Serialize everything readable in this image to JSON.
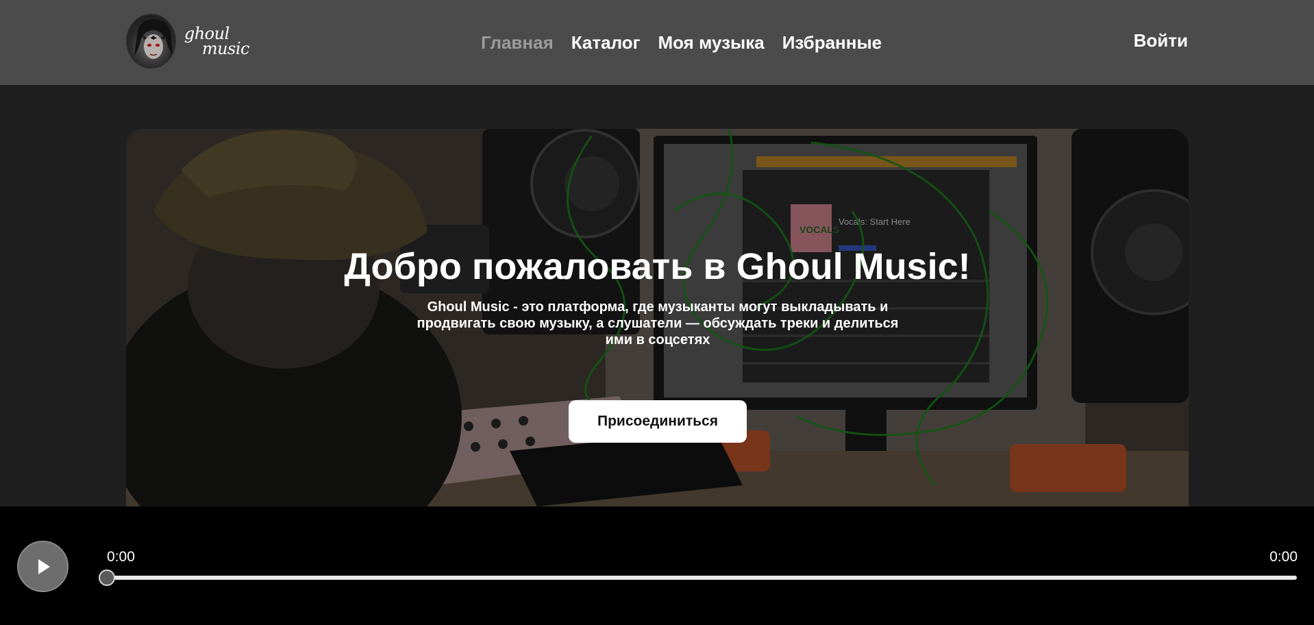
{
  "header": {
    "logo": {
      "line1": "ghoul",
      "line2": "music"
    },
    "nav": [
      {
        "label": "Главная",
        "active": true
      },
      {
        "label": "Каталог",
        "active": false
      },
      {
        "label": "Моя музыка",
        "active": false
      },
      {
        "label": "Избранные",
        "active": false
      }
    ],
    "login_label": "Войти"
  },
  "hero": {
    "title": "Добро пожаловать в Ghoul Music!",
    "description": "Ghoul Music - это платформа, где музыканты могут выкладывать и продвигать свою музыку, а слушатели — обсуждать треки и делиться ими в соцсетях",
    "join_label": "Присоединиться",
    "screen_text": {
      "heading": "Vocals: Start Here",
      "cover": "VOCALS"
    }
  },
  "player": {
    "current_time": "0:00",
    "duration": "0:00",
    "progress": 0,
    "play_icon": "play-icon"
  },
  "colors": {
    "header_bg": "#4b4b4b",
    "page_bg": "#1f1f1f",
    "player_bg": "#000000",
    "nav_active": "#9c9c9c",
    "accent_doodle": "#1f8a1f"
  }
}
